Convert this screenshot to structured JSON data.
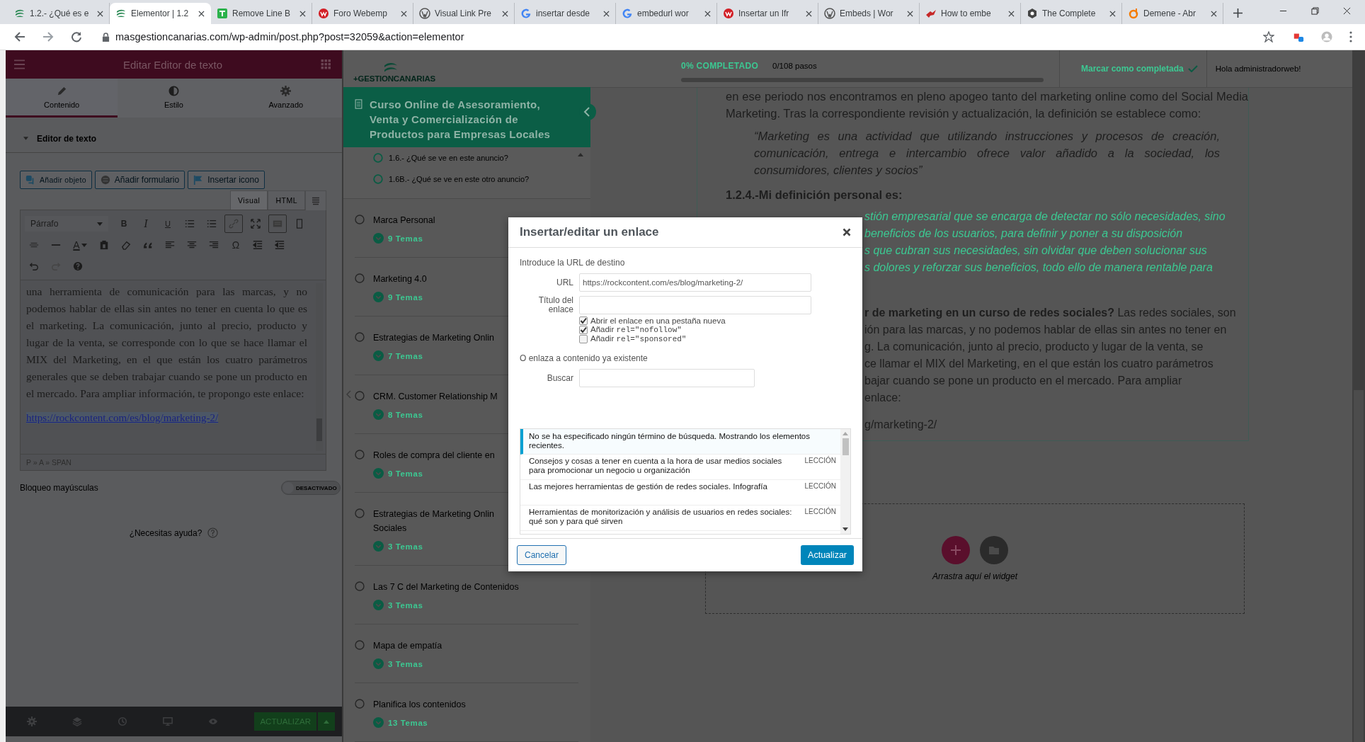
{
  "browser": {
    "tabs": [
      {
        "title": "1.2.- ¿Qué es e",
        "kind": "swirl",
        "selected": false
      },
      {
        "title": "Elementor | 1.2",
        "kind": "swirl",
        "selected": true
      },
      {
        "title": "Remove Line B",
        "kind": "square",
        "selected": false
      },
      {
        "title": "Foro Webemp",
        "kind": "red-circle",
        "selected": false
      },
      {
        "title": "Visual Link Pre",
        "kind": "wp",
        "selected": false
      },
      {
        "title": "insertar desde",
        "kind": "google",
        "selected": false
      },
      {
        "title": "embedurl wor",
        "kind": "google",
        "selected": false
      },
      {
        "title": "Insertar un Ifr",
        "kind": "red-circle",
        "selected": false
      },
      {
        "title": "Embeds | Wor",
        "kind": "wp",
        "selected": false
      },
      {
        "title": "How to embe",
        "kind": "bird",
        "selected": false
      },
      {
        "title": "The Complete",
        "kind": "hexagon",
        "selected": false
      },
      {
        "title": "Demene - Abr",
        "kind": "orange-ring",
        "selected": false
      }
    ],
    "url": "masgestioncanarias.com/wp-admin/post.php?post=32059&action=elementor"
  },
  "editor_panel": {
    "title": "Editar Editor de texto",
    "tabs": [
      {
        "label": "Contenido",
        "kind": "pencil",
        "selected": true
      },
      {
        "label": "Estilo",
        "kind": "contrast",
        "selected": false
      },
      {
        "label": "Avanzado",
        "kind": "gear",
        "selected": false
      }
    ],
    "section": {
      "label": "Editor de texto",
      "expanded": true
    },
    "media_buttons": [
      {
        "label": "Añadir objeto",
        "kind": "media"
      },
      {
        "label": "Añadir formulario",
        "kind": "form"
      },
      {
        "label": "Insertar icono",
        "kind": "flag"
      }
    ],
    "mode_tabs": [
      {
        "label": "Visual",
        "selected": true
      },
      {
        "label": "HTML",
        "selected": false
      }
    ],
    "format": "Párrafo",
    "toolbar": [
      [
        {
          "kind": "bold",
          "label": "B",
          "pressed": false
        },
        {
          "kind": "italic",
          "label": "I",
          "pressed": false
        },
        {
          "kind": "underline",
          "label": "U",
          "pressed": false
        },
        {
          "kind": "bullets",
          "pressed": false
        },
        {
          "kind": "numbers",
          "pressed": false
        },
        {
          "kind": "link",
          "pressed": true
        },
        {
          "kind": "fullscreen",
          "pressed": false
        },
        {
          "kind": "toolbar-toggle",
          "pressed": true
        },
        {
          "kind": "rectangle",
          "pressed": false
        }
      ],
      [
        {
          "kind": "strike",
          "pressed": false
        },
        {
          "kind": "rule",
          "pressed": false
        },
        {
          "kind": "text-color",
          "label": "A",
          "pressed": false
        },
        {
          "kind": "paste",
          "pressed": false
        },
        {
          "kind": "eraser",
          "pressed": false
        },
        {
          "kind": "quote",
          "pressed": false
        },
        {
          "kind": "align-left",
          "pressed": false
        },
        {
          "kind": "align-center",
          "pressed": false
        },
        {
          "kind": "align-right",
          "pressed": false
        },
        {
          "kind": "symbol",
          "label": "Ω",
          "pressed": false
        },
        {
          "kind": "outdent",
          "pressed": false
        },
        {
          "kind": "indent",
          "pressed": false
        }
      ],
      [
        {
          "kind": "undo",
          "pressed": false
        },
        {
          "kind": "redo",
          "pressed": false
        },
        {
          "kind": "help",
          "pressed": false
        }
      ]
    ],
    "text": "una herramienta de comunicación para las marcas, y no podemos hablar de ellas sin antes no tener en cuenta lo que es el marketing. La comunicación, junto al precio, producto y lugar de la venta, se corresponde con lo que se hace llamar el MIX del Marketing, en el que están los cuatro parámetros generales que se deben trabajar cuando se pone un producto en el mercado. Para ampliar información, te propongo este enlace:",
    "link": "https://rockcontent.com/es/blog/marketing-2/",
    "path": "P » A » SPAN",
    "caps_lock": {
      "label": "Bloqueo mayúsculas",
      "on": false,
      "state_text": "DESACTIVADO"
    },
    "help": "¿Necesitas ayuda?",
    "update_button": "ACTUALIZAR"
  },
  "course": {
    "logo": "+GESTIONCANARIAS",
    "title": "Curso Online de Asesoramiento, Venta y Comercialización de Productos para Empresas Locales",
    "lessons": [
      {
        "title": "1.6.- ¿Qué se ve en este anuncio?",
        "done": false
      },
      {
        "title": "1.6B.- ¿Qué se ve en este otro anuncio?",
        "done": false
      }
    ],
    "sections": [
      {
        "title_lines": [
          "Marca Personal"
        ],
        "topics": "9 Temas",
        "done": false
      },
      {
        "title_lines": [
          "Marketing 4.0"
        ],
        "topics": "9 Temas",
        "done": false
      },
      {
        "title_lines": [
          "Estrategias de Marketing Onlin"
        ],
        "topics": "7 Temas",
        "done": false
      },
      {
        "title_lines": [
          "CRM. Customer Relationship M"
        ],
        "topics": "8 Temas",
        "done": false
      },
      {
        "title_lines": [
          "Roles de compra del cliente en"
        ],
        "topics": "9 Temas",
        "done": false
      },
      {
        "title_lines": [
          "Estrategias de Marketing Onlin",
          "Sociales"
        ],
        "topics": "3 Temas",
        "done": false
      },
      {
        "title_lines": [
          "Las 7 C del Marketing de Contenidos"
        ],
        "topics": "3 Temas",
        "done": false
      },
      {
        "title_lines": [
          "Mapa de empatía"
        ],
        "topics": "3 Temas",
        "done": false
      },
      {
        "title_lines": [
          "Planifica los contenidos"
        ],
        "topics": "13 Temas",
        "done": false
      }
    ]
  },
  "lesson_view": {
    "progress": {
      "label": "0% COMPLETADO",
      "steps": "0/108 pasos",
      "level": 0
    },
    "mark_complete": "Marcar como completada",
    "greeting": "Hola administradorweb!",
    "blocks": [
      {
        "kind": "paragraph",
        "text": "en ese periodo nos encontramos en pleno apogeo tanto del marketing online como del Social Media Marketing. Tras la correspondiente revisión y actualización, la definición se establece como:"
      },
      {
        "kind": "quote",
        "text": "“Marketing es una actividad que utilizando instrucciones y procesos de creación, comunicación, entrega e intercambio ofrece valor añadido a la sociedad, los consumidores, clientes y socios”"
      },
      {
        "kind": "heading",
        "text": "1.2.4.-Mi definición personal es:"
      },
      {
        "kind": "cut-quote",
        "lines": [
          "stión empresarial que se encarga de detectar no sólo necesidades, sino",
          "beneficios de los usuarios, para definir y poner a su disposición",
          "s que cubran sus necesidades, sin olvidar que deben solucionar sus",
          "s dolores y reforzar sus beneficios, todo ello de manera rentable para"
        ]
      },
      {
        "kind": "cut-paragraph",
        "lines": [
          "**r de marketing en un curso de redes sociales?** Las redes sociales, son",
          "ión para las marcas, y no podemos hablar de ellas sin antes no tener en",
          "g. La comunicación, junto al precio, producto y lugar de la venta, se",
          "ce llamar el MIX del Marketing, en el que están los cuatro parámetros",
          "bajar cuando se pone un producto en el mercado. Para ampliar",
          "enlace:"
        ]
      },
      {
        "kind": "cut-link",
        "lines": [
          "g/marketing-2/"
        ]
      }
    ],
    "drop_hint": "Arrastra aquí el widget"
  },
  "dialog": {
    "title": "Insertar/editar un enlace",
    "url_prompt": "Introduce la URL de destino",
    "url_label": "URL",
    "url": "https://rockcontent.com/es/blog/marketing-2/",
    "title_label": "Título del enlace",
    "options": [
      {
        "label": "Abrir el enlace en una pestaña nueva",
        "checked": true
      },
      {
        "label": "Añadir",
        "code": "rel=\"nofollow\"",
        "checked": true
      },
      {
        "label": "Añadir",
        "code": "rel=\"sponsored\"",
        "checked": false
      }
    ],
    "existing_label": "O enlaza a contenido ya existente",
    "search_label": "Buscar",
    "notice": "No se ha especificado ningún término de búsqueda. Mostrando los elementos recientes.",
    "results": [
      {
        "title": "Consejos y cosas a tener en cuenta a la hora de usar medios sociales para promocionar un negocio u organización",
        "type": "LECCIÓN"
      },
      {
        "title": "Las mejores herramientas de gestión de redes sociales. Infografía",
        "type": "LECCIÓN"
      },
      {
        "title": "Herramientas de monitorización y análisis de usuarios en redes sociales: qué son y para qué sirven",
        "type": "LECCIÓN"
      }
    ],
    "cancel": "Cancelar",
    "submit": "Actualizar"
  }
}
